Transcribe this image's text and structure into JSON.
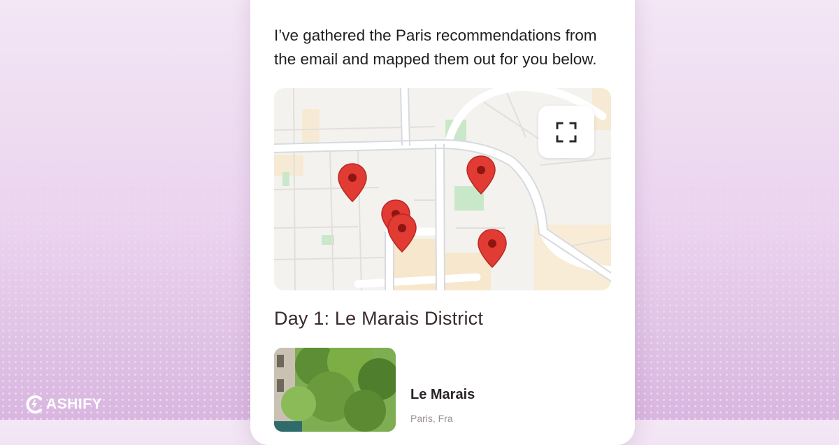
{
  "message": {
    "line1": "I’ve gathered the Paris recommendations from",
    "line2": "the email and mapped them out for you below."
  },
  "map": {
    "expand_icon": "fullscreen-icon",
    "pin_color": "#e23b34",
    "pin_count": 5
  },
  "itinerary": {
    "day_title": "Day 1: Le Marais District",
    "places": [
      {
        "name": "Le Marais",
        "subtitle": "Paris, Fra"
      }
    ]
  },
  "watermark": {
    "brand": "ASHIFY",
    "logo_icon": "cashify-logo-icon"
  },
  "colors": {
    "background": "#ead3ee",
    "card": "#ffffff",
    "pin": "#e23b34"
  }
}
